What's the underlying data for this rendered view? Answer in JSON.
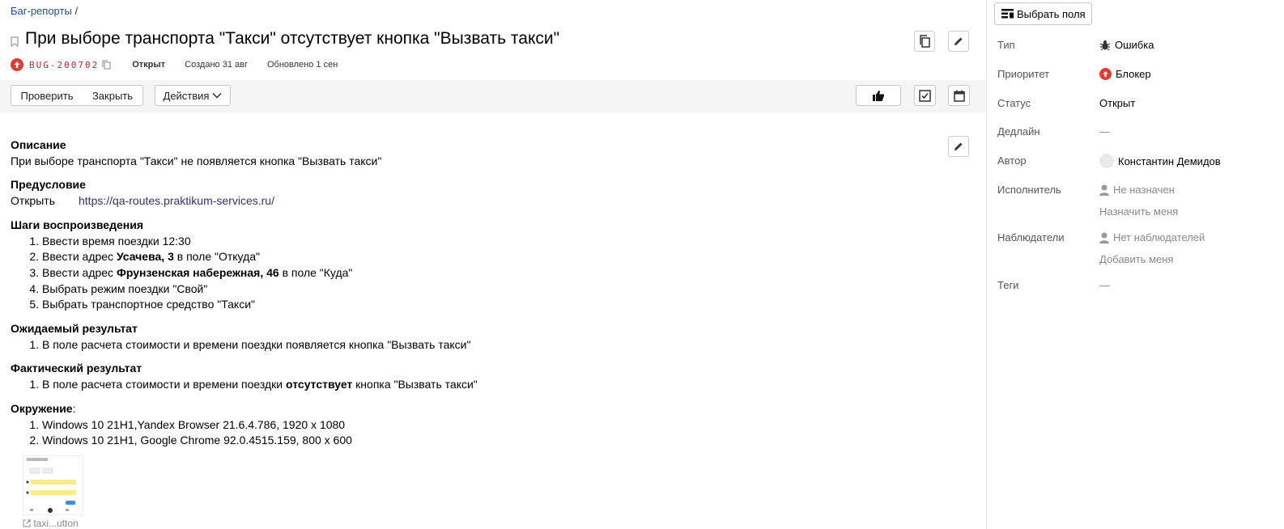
{
  "breadcrumb": {
    "parent": "Баг-репорты",
    "sep": "/"
  },
  "issue": {
    "title": "При выборе транспорта \"Такси\" отсутствует кнопка \"Вызвать такси\"",
    "key": "BUG-200702",
    "status": "Открыт",
    "created": "Создано 31 авг",
    "updated": "Обновлено 1 сен"
  },
  "toolbar": {
    "check": "Проверить",
    "close": "Закрыть",
    "actions": "Действия"
  },
  "description": {
    "heading": "Описание",
    "text": "При выборе транспорта \"Такси\" не появляется кнопка \"Вызвать такси\"",
    "precondition_heading": "Предусловие",
    "precondition_key": "Открыть",
    "precondition_link": "https://qa-routes.praktikum-services.ru/",
    "steps_heading": "Шаги воспроизведения",
    "steps": [
      {
        "pre": "Ввести время поездки 12:30",
        "bold": "",
        "post": ""
      },
      {
        "pre": "Ввести адрес ",
        "bold": "Усачева, 3",
        "post": " в поле \"Откуда\""
      },
      {
        "pre": "Ввести адрес ",
        "bold": "Фрунзенская набережная, 46",
        "post": " в поле \"Куда\""
      },
      {
        "pre": "Выбрать режим поездки \"Свой\"",
        "bold": "",
        "post": ""
      },
      {
        "pre": "Выбрать транспортное средство \"Такси\"",
        "bold": "",
        "post": ""
      }
    ],
    "expected_heading": "Ожидаемый результат",
    "expected": "В поле расчета стоимости и времени поездки появляется кнопка \"Вызвать такси\"",
    "actual_heading": "Фактический результат",
    "actual_pre": "В поле расчета стоимости и времени поездки ",
    "actual_bold": "отсутствует",
    "actual_post": " кнопка \"Вызвать такси\"",
    "env_heading": "Окружение",
    "env_colon": ":",
    "env": [
      "Windows 10 21H1,Yandex Browser 21.6.4.786, 1920 x 1080",
      "Windows 10 21H1, Google Chrome 92.0.4515.159, 800 x 600"
    ],
    "attachment_name": "taxi...utton"
  },
  "sidebar": {
    "select_fields": "Выбрать поля",
    "fields": {
      "type_label": "Тип",
      "type_value": "Ошибка",
      "priority_label": "Приоритет",
      "priority_value": "Блокер",
      "status_label": "Статус",
      "status_value": "Открыт",
      "deadline_label": "Дедлайн",
      "deadline_value": "—",
      "author_label": "Автор",
      "author_value": "Константин Демидов",
      "assignee_label": "Исполнитель",
      "assignee_value": "Не назначен",
      "assign_me": "Назначить меня",
      "watchers_label": "Наблюдатели",
      "watchers_value": "Нет наблюдателей",
      "add_me": "Добавить меня",
      "tags_label": "Теги",
      "tags_value": "—"
    }
  },
  "colors": {
    "accent_red": "#e23b32",
    "link": "#1a4d9c"
  }
}
